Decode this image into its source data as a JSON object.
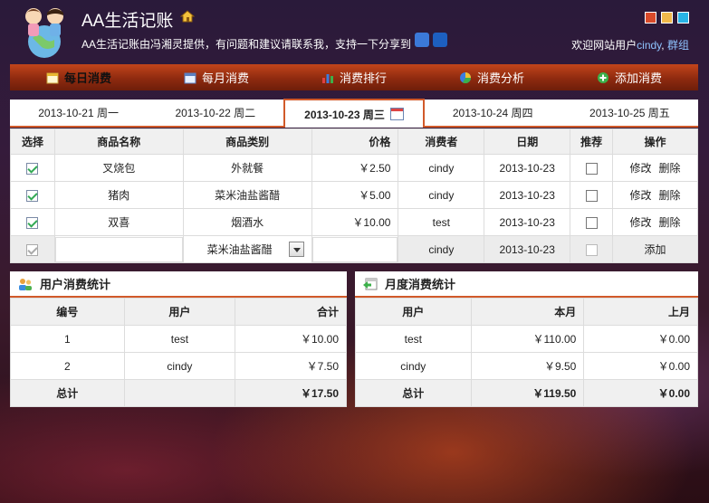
{
  "header": {
    "title": "AA生活记账",
    "description": "AA生活记账由冯湘灵提供，有问题和建议请联系我，支持一下分享到",
    "welcome_prefix": "欢迎网站用户",
    "user_link": "cindy",
    "separator": ",",
    "group_link": "群组",
    "theme_colors": [
      "#d84a2a",
      "#f0b84a",
      "#28b4e6"
    ]
  },
  "nav": [
    {
      "label": "每日消费",
      "icon": "calendar-day-icon"
    },
    {
      "label": "每月消费",
      "icon": "calendar-month-icon"
    },
    {
      "label": "消费排行",
      "icon": "bar-chart-icon"
    },
    {
      "label": "消费分析",
      "icon": "pie-chart-icon"
    },
    {
      "label": "添加消费",
      "icon": "add-icon"
    }
  ],
  "date_tabs": [
    {
      "label": "2013-10-21 周一"
    },
    {
      "label": "2013-10-22 周二"
    },
    {
      "label": "2013-10-23 周三",
      "active": true
    },
    {
      "label": "2013-10-24 周四"
    },
    {
      "label": "2013-10-25 周五"
    }
  ],
  "main_table": {
    "headers": {
      "select": "选择",
      "name": "商品名称",
      "category": "商品类别",
      "price": "价格",
      "consumer": "消费者",
      "date": "日期",
      "recommend": "推荐",
      "action": "操作"
    },
    "rows": [
      {
        "name": "叉烧包",
        "category": "外就餐",
        "price": "￥2.50",
        "consumer": "cindy",
        "date": "2013-10-23",
        "edit": "修改",
        "delete": "删除"
      },
      {
        "name": "猪肉",
        "category": "菜米油盐酱醋",
        "price": "￥5.00",
        "consumer": "cindy",
        "date": "2013-10-23",
        "edit": "修改",
        "delete": "删除"
      },
      {
        "name": "双喜",
        "category": "烟酒水",
        "price": "￥10.00",
        "consumer": "test",
        "date": "2013-10-23",
        "edit": "修改",
        "delete": "删除"
      }
    ],
    "add_row": {
      "category_selected": "菜米油盐酱醋",
      "consumer": "cindy",
      "date": "2013-10-23",
      "add_label": "添加"
    }
  },
  "user_stats": {
    "title": "用户消费统计",
    "headers": {
      "no": "编号",
      "user": "用户",
      "total": "合计"
    },
    "rows": [
      {
        "no": "1",
        "user": "test",
        "total": "￥10.00"
      },
      {
        "no": "2",
        "user": "cindy",
        "total": "￥7.50"
      }
    ],
    "sum_label": "总计",
    "sum_total": "￥17.50"
  },
  "month_stats": {
    "title": "月度消费统计",
    "headers": {
      "user": "用户",
      "this_month": "本月",
      "last_month": "上月"
    },
    "rows": [
      {
        "user": "test",
        "this_month": "￥110.00",
        "last_month": "￥0.00"
      },
      {
        "user": "cindy",
        "this_month": "￥9.50",
        "last_month": "￥0.00"
      }
    ],
    "sum_label": "总计",
    "sum_this": "￥119.50",
    "sum_last": "￥0.00"
  }
}
